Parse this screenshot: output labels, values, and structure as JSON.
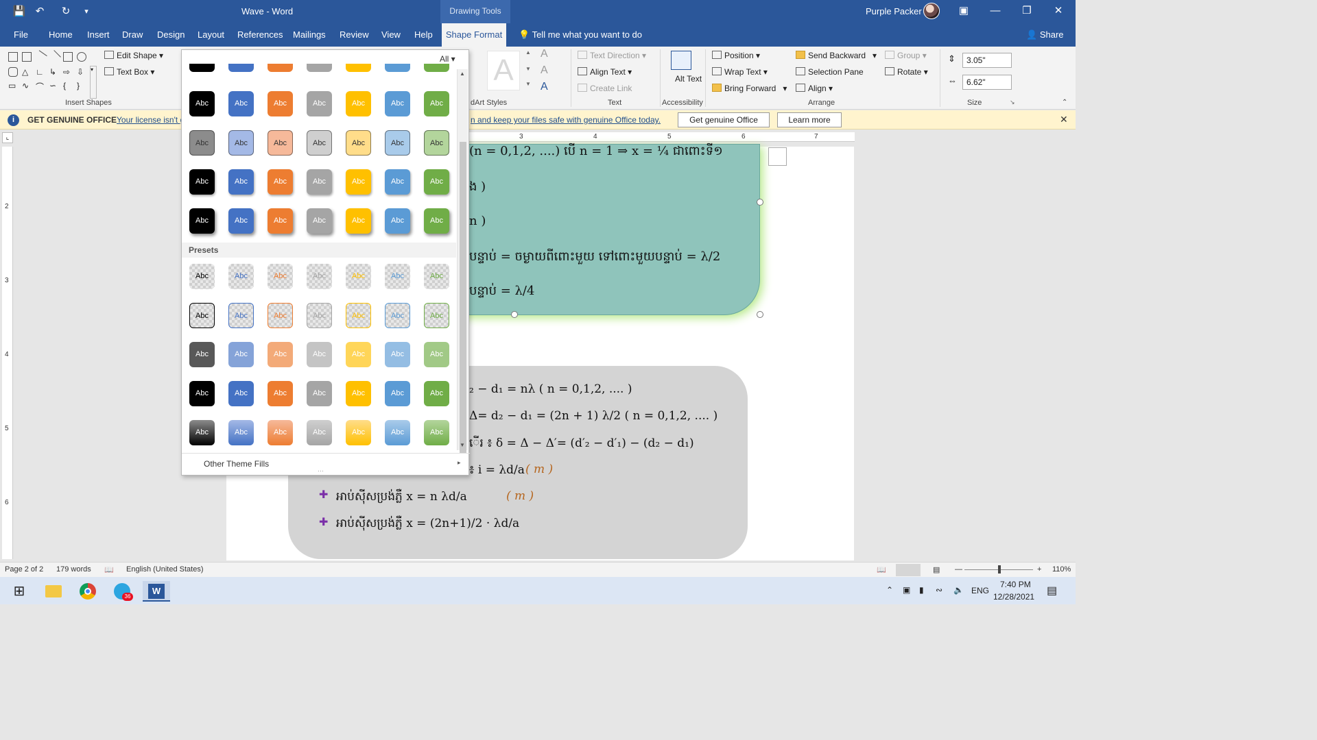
{
  "titlebar": {
    "doc_title": "Wave  -  Word",
    "drawing_tools": "Drawing Tools",
    "user_name": "Purple Packer"
  },
  "tabs": [
    "File",
    "Home",
    "Insert",
    "Draw",
    "Design",
    "Layout",
    "References",
    "Mailings",
    "Review",
    "View",
    "Help"
  ],
  "active_tab": "Shape Format",
  "tell_me": "Tell me what you want to do",
  "share": "Share",
  "ribbon": {
    "insert_shapes": {
      "label": "Insert Shapes",
      "edit_shape": "Edit Shape",
      "text_box": "Text Box"
    },
    "wordart_label": "dArt Styles",
    "text": {
      "label": "Text",
      "text_direction": "Text Direction",
      "align_text": "Align Text",
      "create_link": "Create Link"
    },
    "accessibility": {
      "label": "Accessibility",
      "alt_text": "Alt Text"
    },
    "arrange": {
      "label": "Arrange",
      "position": "Position",
      "wrap_text": "Wrap Text",
      "bring_forward": "Bring Forward",
      "send_backward": "Send Backward",
      "selection_pane": "Selection Pane",
      "align": "Align",
      "group": "Group",
      "rotate": "Rotate"
    },
    "size": {
      "label": "Size",
      "height": "3.05\"",
      "width": "6.62\""
    }
  },
  "license": {
    "heading": "GET GENUINE OFFICE",
    "link1": "Your license isn't g",
    "link2": "n and keep your files safe with genuine Office today.",
    "btn_genuine": "Get genuine Office",
    "btn_learn": "Learn more"
  },
  "gallery": {
    "filter": "All",
    "swatch_label": "Abc",
    "theme_colors": [
      "#000000",
      "#4472c4",
      "#ed7d31",
      "#a5a5a5",
      "#ffc000",
      "#5b9bd5",
      "#70ad47"
    ],
    "theme_light": [
      "#8c8c8c",
      "#a4b9e6",
      "#f6b99a",
      "#cfcfcf",
      "#ffdd8a",
      "#a9cbea",
      "#b3d59c"
    ],
    "presets_label": "Presets",
    "other_fills": "Other Theme Fills"
  },
  "teal_lines": {
    "l1": "(n = 0,1,2, ....) បើ n = 1 ⇒ x = ¼ ជាពោះទី១",
    "l2": "ង )",
    "l3": "n )",
    "l4": "បន្ទាប់ = ចម្ងាយពីពោះមួយ ទៅពោះមួយបន្ទាប់ = λ/2",
    "l5": "បន្ទាប់ = λ/4"
  },
  "gray_lines": {
    "g1": "₂ − d₁ = nλ   ( n = 0,1,2, .... )",
    "g2": "Δ= d₂ − d₁ = (2n + 1) λ/2    ( n = 0,1,2, .... )",
    "g3": "ើរ ៖ δ = Δ − Δ′= (d′₂ − d′₁) − (d₂ − d₁)",
    "g4": "៖ i = λd/a",
    "g4_unit": "( m )",
    "g5": "អាប់ស៊ីសប្រង់ភ្លឺ x = n λd/a",
    "g5_unit": "( m )",
    "g6": "អាប់ស៊ីសប្រង់ភ្លឺ x = (2n+1)/2 · λd/a"
  },
  "statusbar": {
    "page": "Page 2 of 2",
    "words": "179 words",
    "language": "English (United States)",
    "zoom": "110%"
  },
  "taskbar": {
    "telegram_badge": "36",
    "lang": "ENG",
    "time": "7:40 PM",
    "date": "12/28/2021"
  }
}
